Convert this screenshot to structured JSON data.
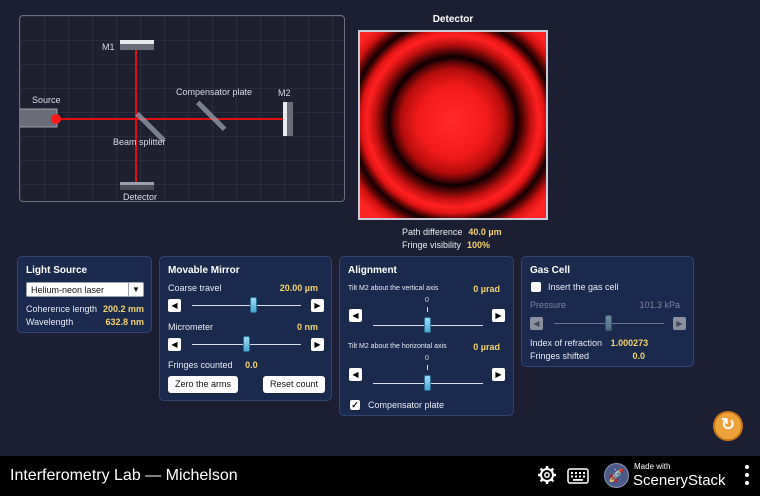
{
  "stage": {
    "labels": {
      "m1": "M1",
      "m2": "M2",
      "source": "Source",
      "compensator": "Compensator plate",
      "beam_splitter": "Beam splitter",
      "detector": "Detector"
    }
  },
  "detector": {
    "title": "Detector",
    "path_difference_label": "Path difference",
    "path_difference_value": "40.0 µm",
    "fringe_visibility_label": "Fringe visibility",
    "fringe_visibility_value": "100%"
  },
  "light_source": {
    "title": "Light Source",
    "selected": "Helium-neon laser",
    "coherence_label": "Coherence length",
    "coherence_value": "200.2 mm",
    "wavelength_label": "Wavelength",
    "wavelength_value": "632.8 nm"
  },
  "movable_mirror": {
    "title": "Movable Mirror",
    "coarse_label": "Coarse travel",
    "coarse_value": "20.00 µm",
    "coarse_level": 0.5,
    "micrometer_label": "Micrometer",
    "micrometer_value": "0 nm",
    "micrometer_level": 0.5,
    "fringes_label": "Fringes counted",
    "fringes_value": "0.0",
    "zero_button": "Zero the arms",
    "reset_count_button": "Reset count"
  },
  "alignment": {
    "title": "Alignment",
    "tilt_vertical_label": "Tilt M2 about the vertical axis",
    "tilt_vertical_value": "0 µrad",
    "tilt_horizontal_label": "Tilt M2 about the horizontal axis",
    "tilt_horizontal_value": "0 µrad",
    "tick_zero": "0",
    "compensator_label": "Compensator plate",
    "compensator_checked": true
  },
  "gas_cell": {
    "title": "Gas Cell",
    "insert_label": "Insert the gas cell",
    "insert_checked": false,
    "pressure_label": "Pressure",
    "pressure_value": "101.3 kPa",
    "pressure_level": 0.5,
    "refraction_label": "Index of refraction",
    "refraction_value": "1.000273",
    "shifted_label": "Fringes shifted",
    "shifted_value": "0.0"
  },
  "navbar": {
    "title": "Interferometry Lab — Michelson",
    "made_with": "Made with",
    "brand": "SceneryStack"
  },
  "icons": {
    "settings": "gear-icon",
    "keyboard": "keyboard-icon",
    "reset": "reset-all-icon",
    "menu": "kebab-menu-icon",
    "left": "triangle-left-icon",
    "right": "triangle-right-icon"
  },
  "colors": {
    "background": "#1c1e33",
    "panel": "#1a2a4c",
    "value": "#f5d36c",
    "beam": "#ff1a1a",
    "reset": "#f0a23a"
  }
}
